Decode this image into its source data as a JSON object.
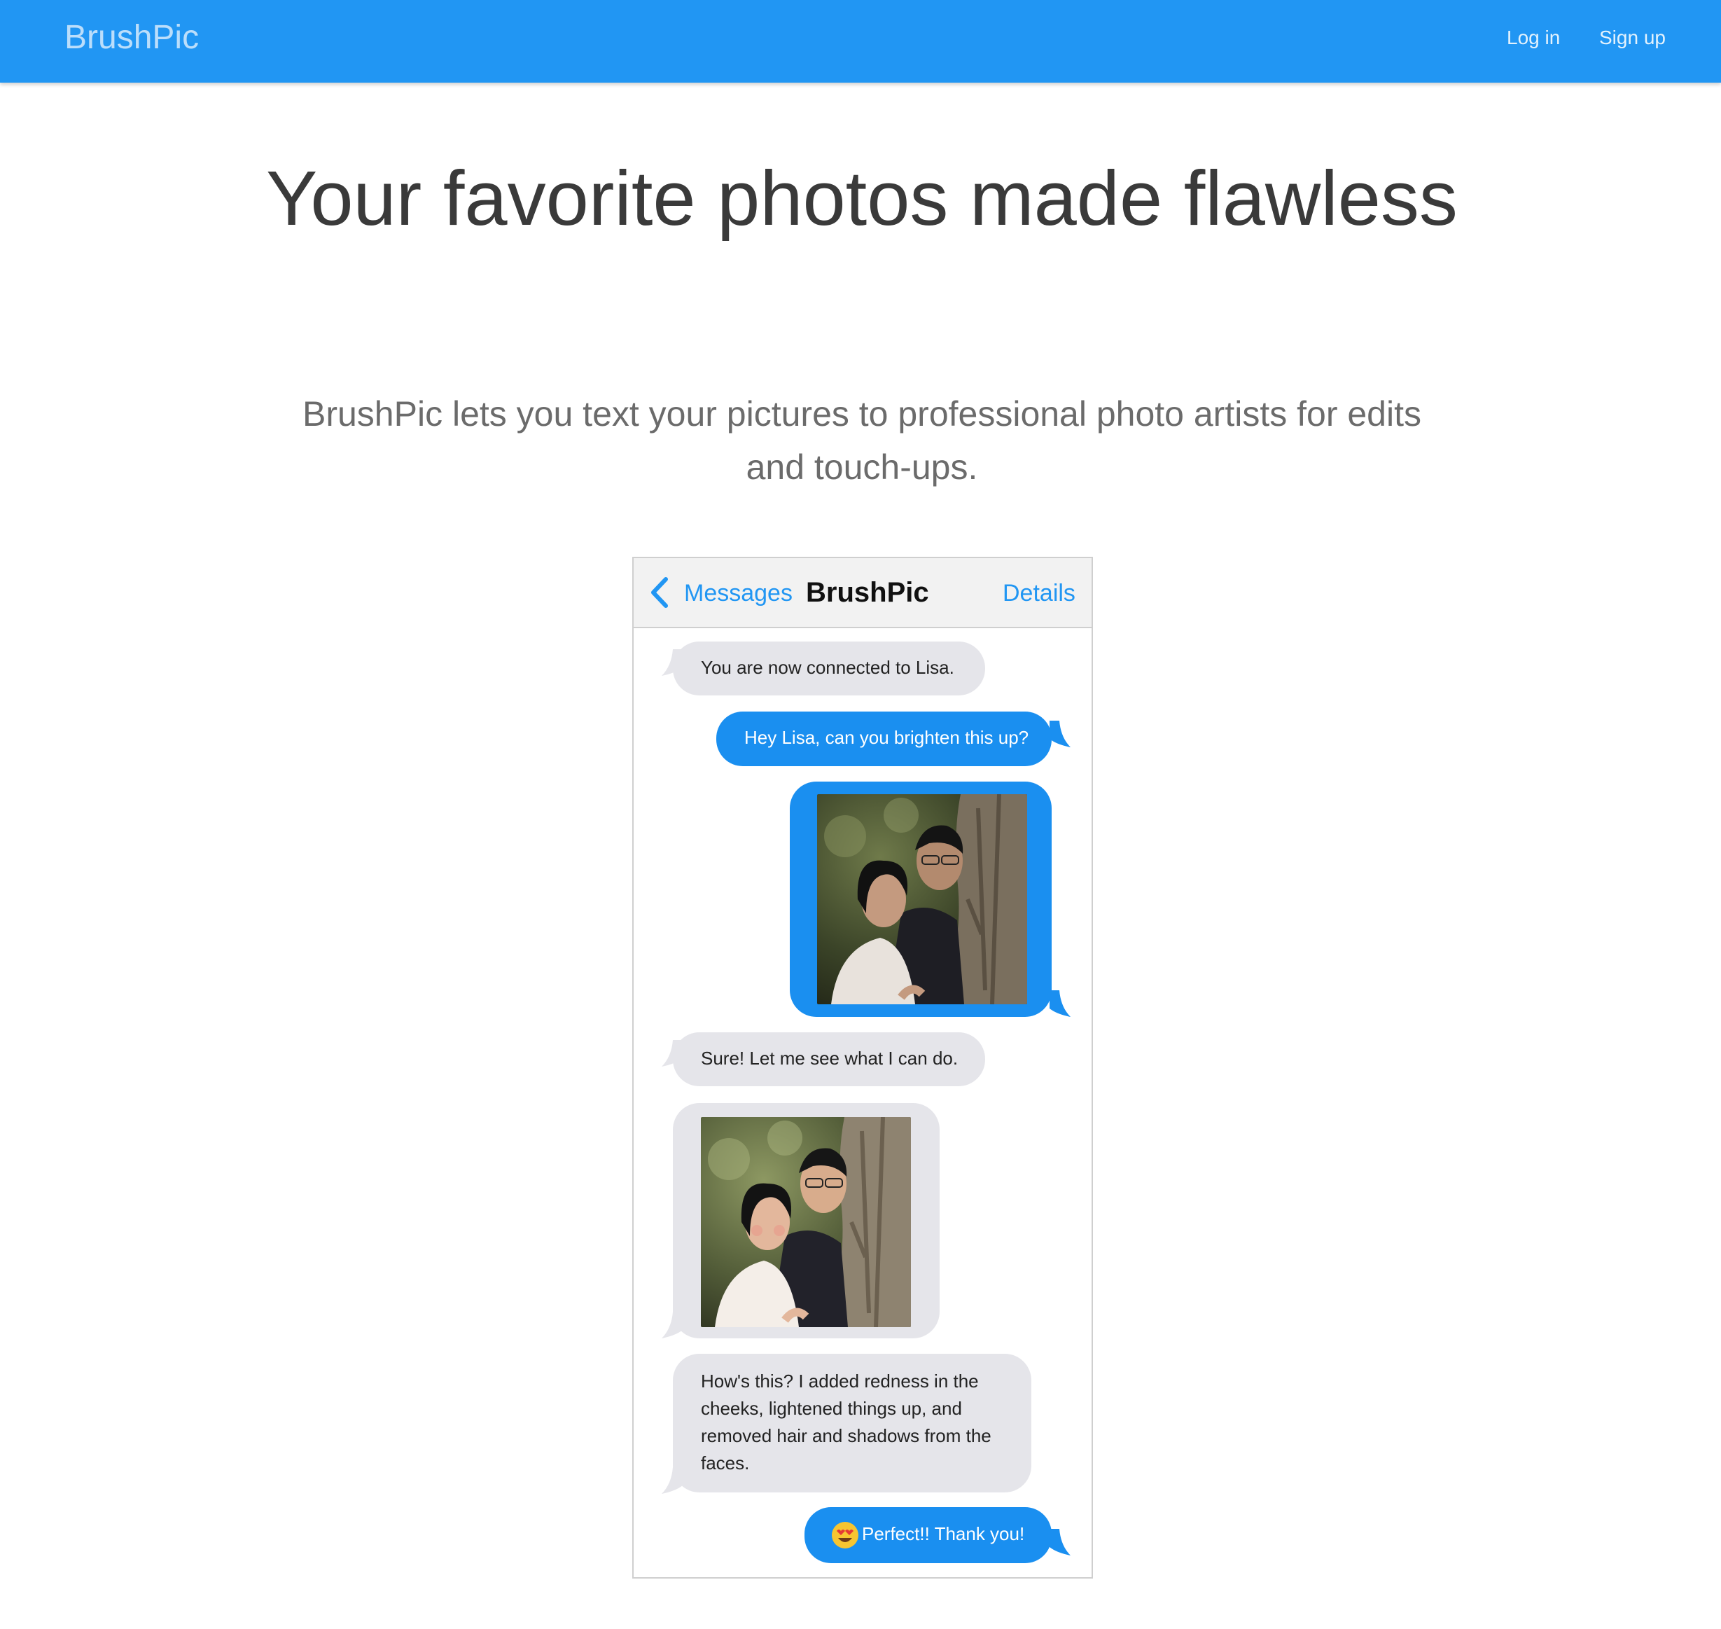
{
  "navbar": {
    "brand": "BrushPic",
    "login": "Log in",
    "signup": "Sign up"
  },
  "hero": {
    "headline": "Your favorite photos made flawless",
    "subhead": "BrushPic lets you text your pictures to professional photo artists for edits and touch-ups."
  },
  "phone": {
    "back_label": "Messages",
    "title": "BrushPic",
    "details": "Details",
    "messages": [
      {
        "from": "artist",
        "text": "You are now connected to Lisa."
      },
      {
        "from": "user",
        "text": "Hey Lisa, can you brighten this up?"
      },
      {
        "from": "user",
        "photo": "original-couple-photo"
      },
      {
        "from": "artist",
        "text": "Sure! Let me see what I can do."
      },
      {
        "from": "artist",
        "photo": "edited-couple-photo"
      },
      {
        "from": "artist",
        "lines": [
          "How's this? I added redness in the",
          "cheeks, lightened things up, and",
          "removed hair and shadows from the",
          "faces."
        ]
      },
      {
        "from": "user",
        "emoji": "heart-eyes-emoji",
        "text": "Perfect!! Thank you!"
      }
    ]
  },
  "colors": {
    "navbar": "#2196F3",
    "outgoing_bubble": "#1a8ff0",
    "incoming_bubble": "#e5e5ea"
  }
}
